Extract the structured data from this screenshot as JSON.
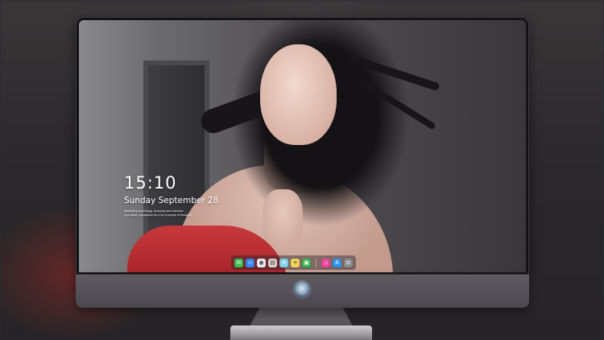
{
  "lock_screen": {
    "time": "15:10",
    "date": "Sunday September 28",
    "caption_line1": "Interesting technology. Amazing user interface.",
    "caption_line2": "your ideas, companion for a lot of people of thoughts."
  },
  "dock": {
    "items": [
      {
        "name": "messages-icon",
        "color": "#3dbb4c",
        "glyph": "✉"
      },
      {
        "name": "finder-icon",
        "color": "#3a86e8",
        "glyph": "☺"
      },
      {
        "name": "safari-icon",
        "color": "#e9e9ee",
        "glyph": "◉"
      },
      {
        "name": "preview-icon",
        "color": "#d8d4cc",
        "glyph": "▤"
      },
      {
        "name": "clapper-icon",
        "color": "#7fd1e8",
        "glyph": "≋"
      },
      {
        "name": "notes-icon",
        "color": "#f3d35a",
        "glyph": "≡"
      },
      {
        "name": "facetime-icon",
        "color": "#38b34b",
        "glyph": "▣"
      },
      {
        "name": "music-icon",
        "color": "#e9459a",
        "glyph": "♫"
      },
      {
        "name": "appstore-icon",
        "color": "#2f92f0",
        "glyph": "A"
      },
      {
        "name": "camera-icon",
        "color": "#8a8a8e",
        "glyph": "◘"
      }
    ]
  },
  "colors": {
    "dress_red": "#b5292f",
    "bezel": "#121214",
    "chin": "#58535a"
  }
}
